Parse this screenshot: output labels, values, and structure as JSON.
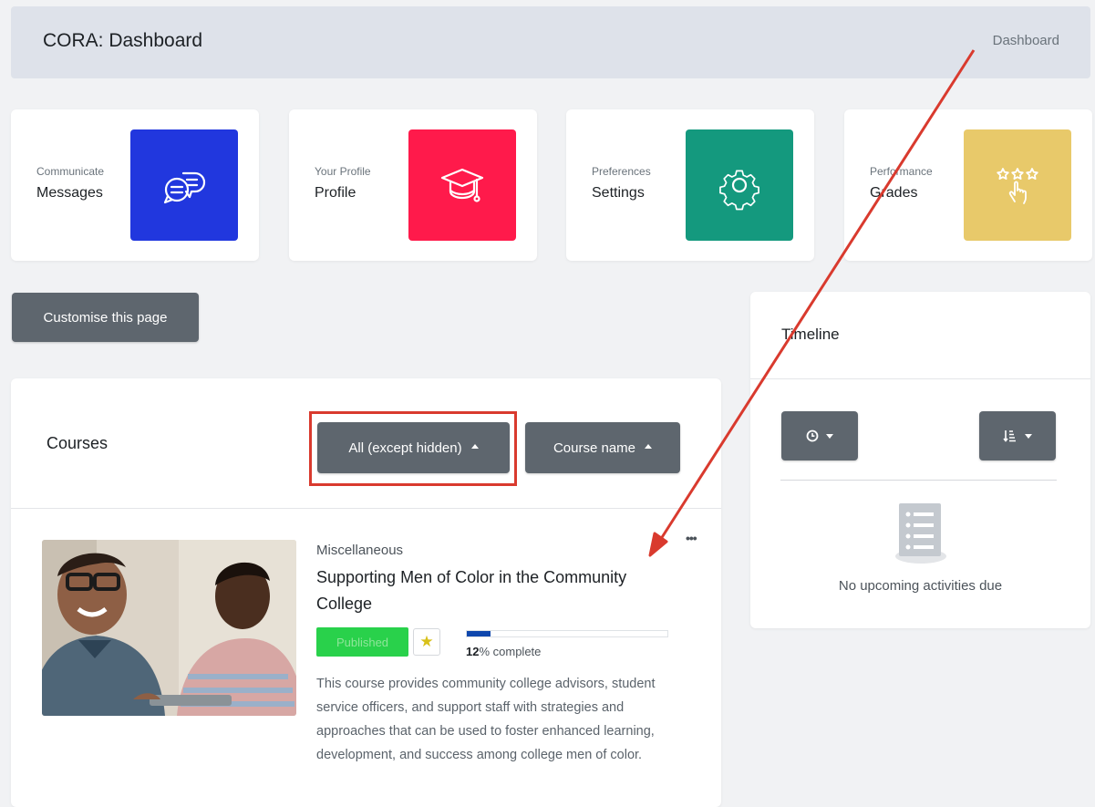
{
  "header": {
    "title": "CORA: Dashboard",
    "breadcrumb": "Dashboard"
  },
  "tiles": [
    {
      "sub": "Communicate",
      "label": "Messages",
      "icon": "chat-bubbles-icon",
      "color": "#2137de"
    },
    {
      "sub": "Your Profile",
      "label": "Profile",
      "icon": "graduation-cap-icon",
      "color": "#ff1a4b"
    },
    {
      "sub": "Preferences",
      "label": "Settings",
      "icon": "gear-icon",
      "color": "#14997e"
    },
    {
      "sub": "Performance",
      "label": "Grades",
      "icon": "stars-hand-icon",
      "color": "#e8c96a"
    }
  ],
  "customise_button": "Customise this page",
  "courses": {
    "title": "Courses",
    "filter_label": "All (except hidden)",
    "sort_label": "Course name",
    "course": {
      "category": "Miscellaneous",
      "name": "Supporting Men of Color in the Community College",
      "status": "Published",
      "progress_percent": 12,
      "progress_number": "12",
      "progress_suffix": "% complete",
      "description": "This course provides community college advisors, student service officers, and support staff with strategies and approaches that can be used to foster enhanced learning, development, and success among college men of color."
    }
  },
  "timeline": {
    "title": "Timeline",
    "empty_text": "No upcoming activities due"
  },
  "colors": {
    "annotation_red": "#d93a2e",
    "dark_button": "#5e666e"
  }
}
